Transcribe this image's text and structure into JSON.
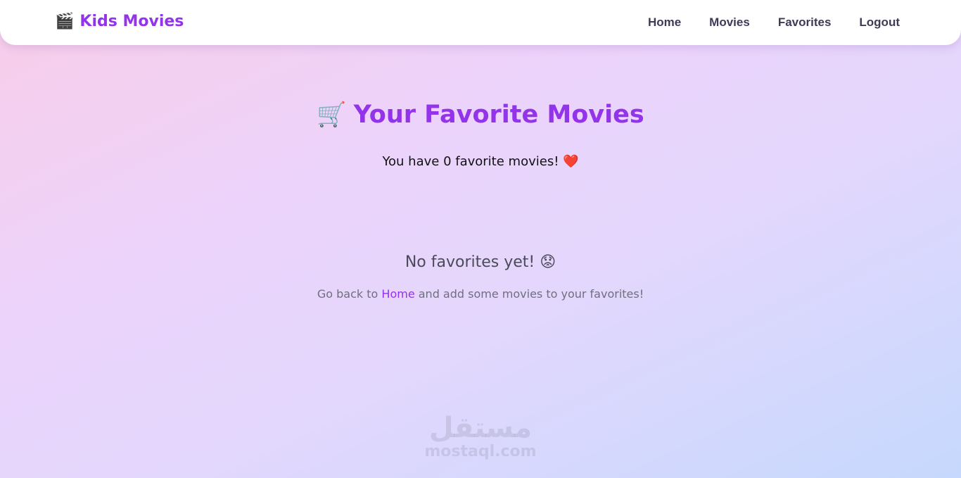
{
  "navbar": {
    "brand_icon": "🎬",
    "brand_text": "Kids Movies",
    "links": [
      {
        "label": "Home"
      },
      {
        "label": "Movies"
      },
      {
        "label": "Favorites"
      },
      {
        "label": "Logout"
      }
    ]
  },
  "main": {
    "title_icon": "🛒",
    "title": "Your Favorite Movies",
    "subtitle_prefix": "You have ",
    "favorite_count": "0",
    "subtitle_suffix": " favorite movies! ",
    "subtitle_icon": "❤️",
    "empty_title": "No favorites yet! ",
    "empty_icon": "😟",
    "empty_hint_prefix": "Go back to ",
    "empty_hint_link": "Home",
    "empty_hint_suffix": " and add some movies to your favorites!"
  },
  "watermark": {
    "arabic": "مستقل",
    "latin": "mostaql.com"
  },
  "colors": {
    "accent": "#9333ea",
    "nav_text": "#3d3c56"
  }
}
